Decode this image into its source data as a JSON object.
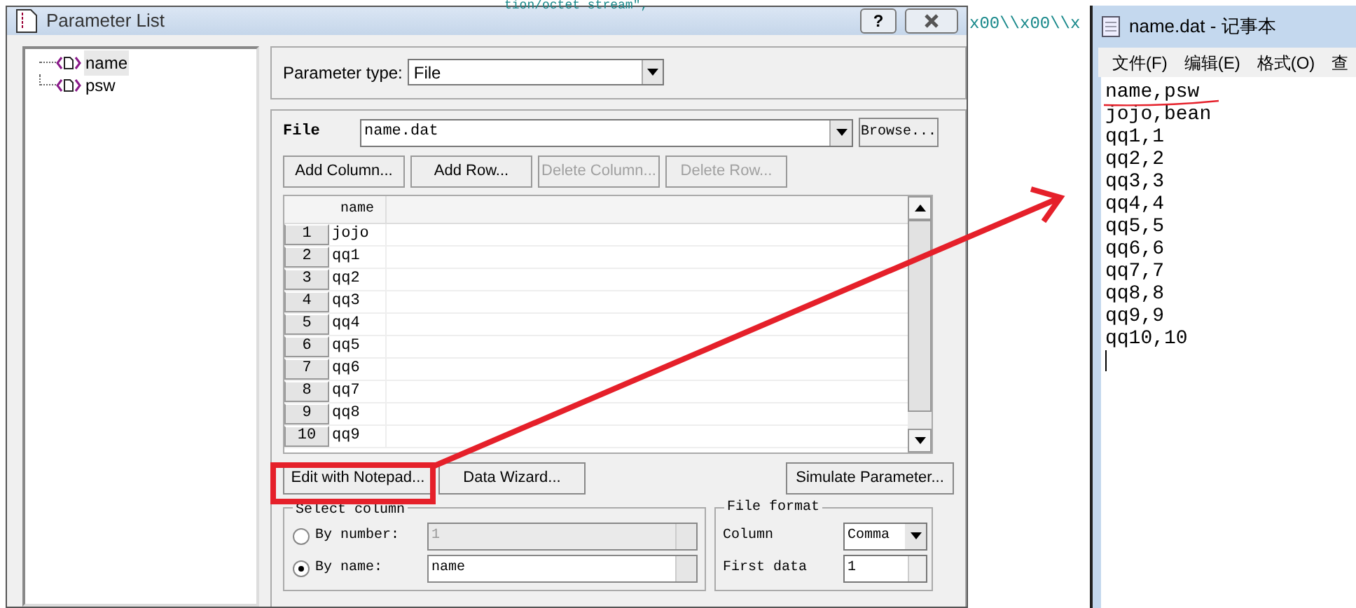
{
  "background_code": [
    "tion/octet stream\",",
    "x00\\\\x00\\\\x"
  ],
  "dialog": {
    "title": "Parameter List",
    "help_button": "?",
    "tree": [
      {
        "label": "name",
        "selected": true
      },
      {
        "label": "psw",
        "selected": false
      }
    ],
    "parameter_type": {
      "label": "Parameter type:",
      "value": "File"
    },
    "file": {
      "label": "File",
      "value": "name.dat",
      "browse": "Browse..."
    },
    "buttons": [
      {
        "label": "Add Column...",
        "disabled": false
      },
      {
        "label": "Add Row...",
        "disabled": false
      },
      {
        "label": "Delete Column...",
        "disabled": true
      },
      {
        "label": "Delete Row...",
        "disabled": true
      }
    ],
    "table": {
      "columns": [
        "name"
      ],
      "rows": [
        {
          "number": "1",
          "name": "jojo"
        },
        {
          "number": "2",
          "name": "qq1"
        },
        {
          "number": "3",
          "name": "qq2"
        },
        {
          "number": "4",
          "name": "qq3"
        },
        {
          "number": "5",
          "name": "qq4"
        },
        {
          "number": "6",
          "name": "qq5"
        },
        {
          "number": "7",
          "name": "qq6"
        },
        {
          "number": "8",
          "name": "qq7"
        },
        {
          "number": "9",
          "name": "qq8"
        },
        {
          "number": "10",
          "name": "qq9"
        }
      ]
    },
    "actions": [
      "Edit with Notepad...",
      "Data Wizard...",
      "Simulate Parameter..."
    ],
    "select_column": {
      "title": "Select column",
      "options": [
        {
          "label": "By number:",
          "selected": false,
          "value": "1",
          "disabled": true
        },
        {
          "label": "By name:",
          "selected": true,
          "value": "name",
          "disabled": false
        }
      ]
    },
    "file_format": {
      "title": "File format",
      "column": {
        "label": "Column",
        "value": "Comma"
      },
      "first_data": {
        "label": "First data",
        "value": "1"
      }
    }
  },
  "notepad": {
    "title": "name.dat - 记事本",
    "menu": [
      "文件(F)",
      "编辑(E)",
      "格式(O)",
      "查"
    ],
    "lines": [
      "name,psw",
      "jojo,bean",
      "qq1,1",
      "qq2,2",
      "qq3,3",
      "qq4,4",
      "qq5,5",
      "qq6,6",
      "qq7,7",
      "qq8,8",
      "qq9,9",
      "qq10,10"
    ]
  }
}
